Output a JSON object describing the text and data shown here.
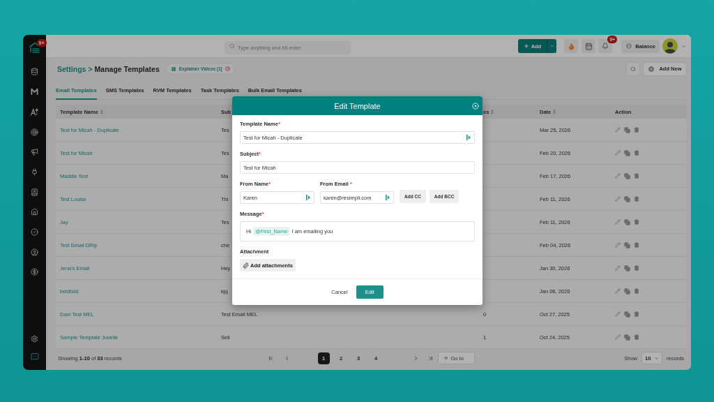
{
  "sidebar": {
    "logo_badge": "9+"
  },
  "topbar": {
    "search": {
      "placeholder": "Type anything and hit enter"
    },
    "add_button": "Add",
    "notification_badge": "9+",
    "balance_button": "Balance"
  },
  "header": {
    "breadcrumb": [
      {
        "label": "Settings",
        "current": false
      },
      {
        "label": "Manage Templates",
        "current": true
      }
    ],
    "separator": ">",
    "explainer_chip": "Explainer Videos (1)",
    "add_new_button": "Add New"
  },
  "tabs": [
    {
      "label": "Email Templates",
      "selected": true
    },
    {
      "label": "SMS Templates",
      "selected": false
    },
    {
      "label": "RVM Templates",
      "selected": false
    },
    {
      "label": "Task Templates",
      "selected": false
    },
    {
      "label": "Bulk Email Templates",
      "selected": false
    }
  ],
  "table": {
    "columns": [
      {
        "label": "Template Name",
        "sortable": true
      },
      {
        "label": "Sub",
        "sortable": false
      },
      {
        "label": "es",
        "sortable": true
      },
      {
        "label": "Date",
        "sortable": true
      },
      {
        "label": "Action",
        "sortable": false
      }
    ],
    "rows": [
      {
        "name": "Test for Micah - Duplicate",
        "subject": "Tes",
        "date": "Mar 25, 2026"
      },
      {
        "name": "Test for Micah",
        "subject": "Tes",
        "date": "Feb 20, 2026"
      },
      {
        "name": "Maddie Test",
        "subject": "Ma",
        "date": "Feb 17, 2026"
      },
      {
        "name": "Test Louise",
        "subject": "Thi",
        "date": "Feb 11, 2026"
      },
      {
        "name": "Jay",
        "subject": "Tes",
        "date": "Feb 11, 2026"
      },
      {
        "name": "Test Email DRip",
        "subject": "che",
        "date": "Feb 04, 2026"
      },
      {
        "name": "Jena's Email",
        "subject": "Hey",
        "date": "Jan 30, 2026"
      },
      {
        "name": "beldhdd",
        "subject": "kjq",
        "date": "Jan 06, 2026"
      },
      {
        "name": "Dani Test MEL",
        "subject": "Test Email MEL",
        "uses": "0",
        "date": "Oct 27, 2025"
      },
      {
        "name": "Sample Template Juvelle",
        "subject": "Sell",
        "uses": "1",
        "date": "Oct 24, 2025"
      }
    ]
  },
  "footer": {
    "summary": "Showing **1-10** of **33** records",
    "pages": [
      {
        "label": "1",
        "selected": true
      },
      {
        "label": "2",
        "selected": false
      },
      {
        "label": "3",
        "selected": false
      },
      {
        "label": "4",
        "selected": false
      }
    ],
    "go_to": "Go to",
    "show_label": "Show",
    "page_size": "10",
    "records_label": "records"
  },
  "modal": {
    "title": "Edit Template",
    "fields": [
      {
        "label": "Template Name",
        "required_mark": "*",
        "value": "Test for Micah - Duplicate",
        "merge_tags": true
      },
      {
        "label": "Subject",
        "required_mark": "*",
        "value": "Test for Micah",
        "merge_tags": false
      }
    ],
    "sender_fields": [
      {
        "label": "From Name",
        "required_mark": "*",
        "value": "Karen",
        "merge_tags": true
      },
      {
        "label": "From Email",
        "required_mark": " *",
        "value": "karen@resimpli.com",
        "merge_tags": true
      }
    ],
    "copy_buttons": [
      "Add CC",
      "Add BCC"
    ],
    "message": {
      "label": "Message",
      "required_mark": "*",
      "parts": [
        {
          "kind": "text",
          "text": "Hi"
        },
        {
          "kind": "tag",
          "text": "@First_Name"
        },
        {
          "kind": "text",
          "text": "I am emailing you"
        }
      ]
    },
    "attachment": {
      "label": "Attachment",
      "button": "Add attachments"
    },
    "actions": [
      {
        "kind": "cancel",
        "label": "Cancel"
      },
      {
        "kind": "primary",
        "label": "Edit"
      }
    ]
  }
}
